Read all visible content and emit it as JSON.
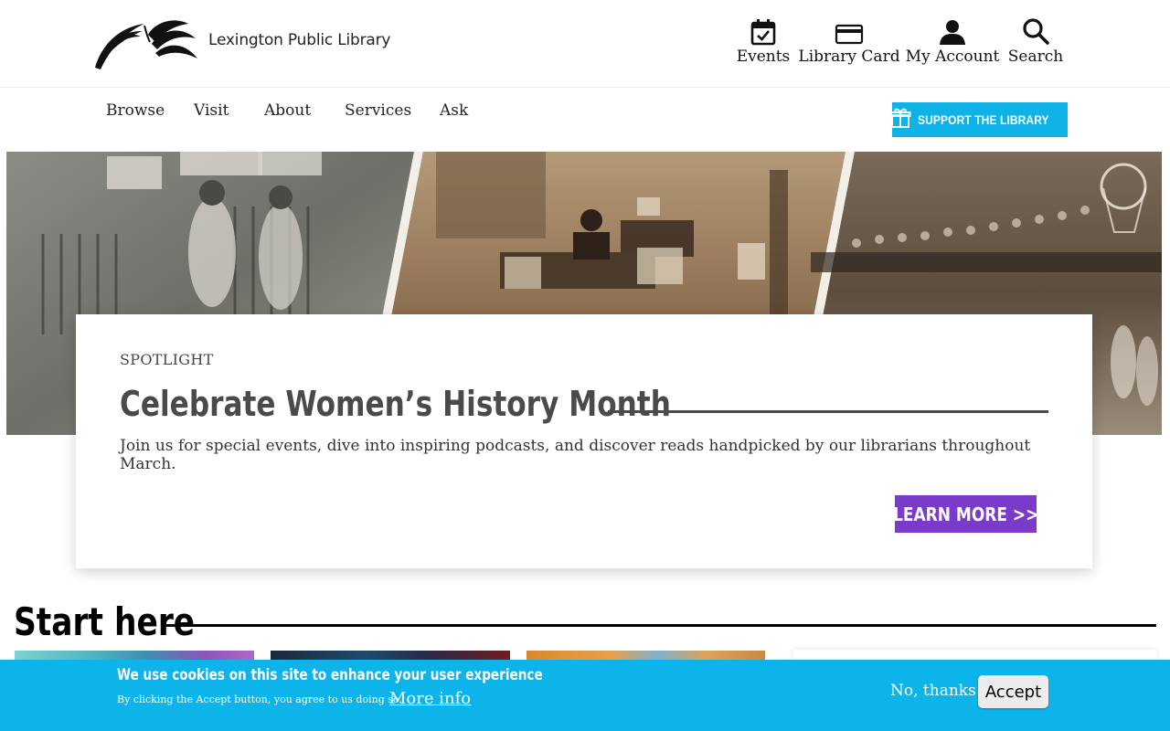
{
  "header": {
    "logo_text": "Lexington Public Library",
    "utility": [
      {
        "icon": "calendar-check-icon",
        "label": "Events"
      },
      {
        "icon": "credit-card-icon",
        "label": "Library Card"
      },
      {
        "icon": "user-icon",
        "label": "My Account"
      },
      {
        "icon": "search-icon",
        "label": "Search"
      }
    ]
  },
  "nav": {
    "items": [
      "Browse",
      "Visit",
      "About",
      "Services",
      "Ask"
    ],
    "support_label": "Support the Library",
    "support_icon": "gift-icon"
  },
  "spotlight": {
    "eyebrow": "SPOTLIGHT",
    "title": "Celebrate Women’s History Month",
    "description": "Join us for special events, dive into inspiring podcasts, and discover reads handpicked by our librarians throughout March.",
    "button_label": "LEARN MORE >>"
  },
  "start_here": {
    "title": "Start here"
  },
  "cookie": {
    "title": "We use cookies on this site to enhance your user experience",
    "text": "By clicking the Accept button, you agree to us doing so.",
    "more_info": "More info",
    "decline": "No, thanks",
    "accept": "Accept"
  },
  "colors": {
    "brand_blue": "#0fb2e6",
    "learn_more_purple": "#7a3cc8",
    "title_gray": "#4a4a4a",
    "cookie_bar": "#0db4ea"
  }
}
